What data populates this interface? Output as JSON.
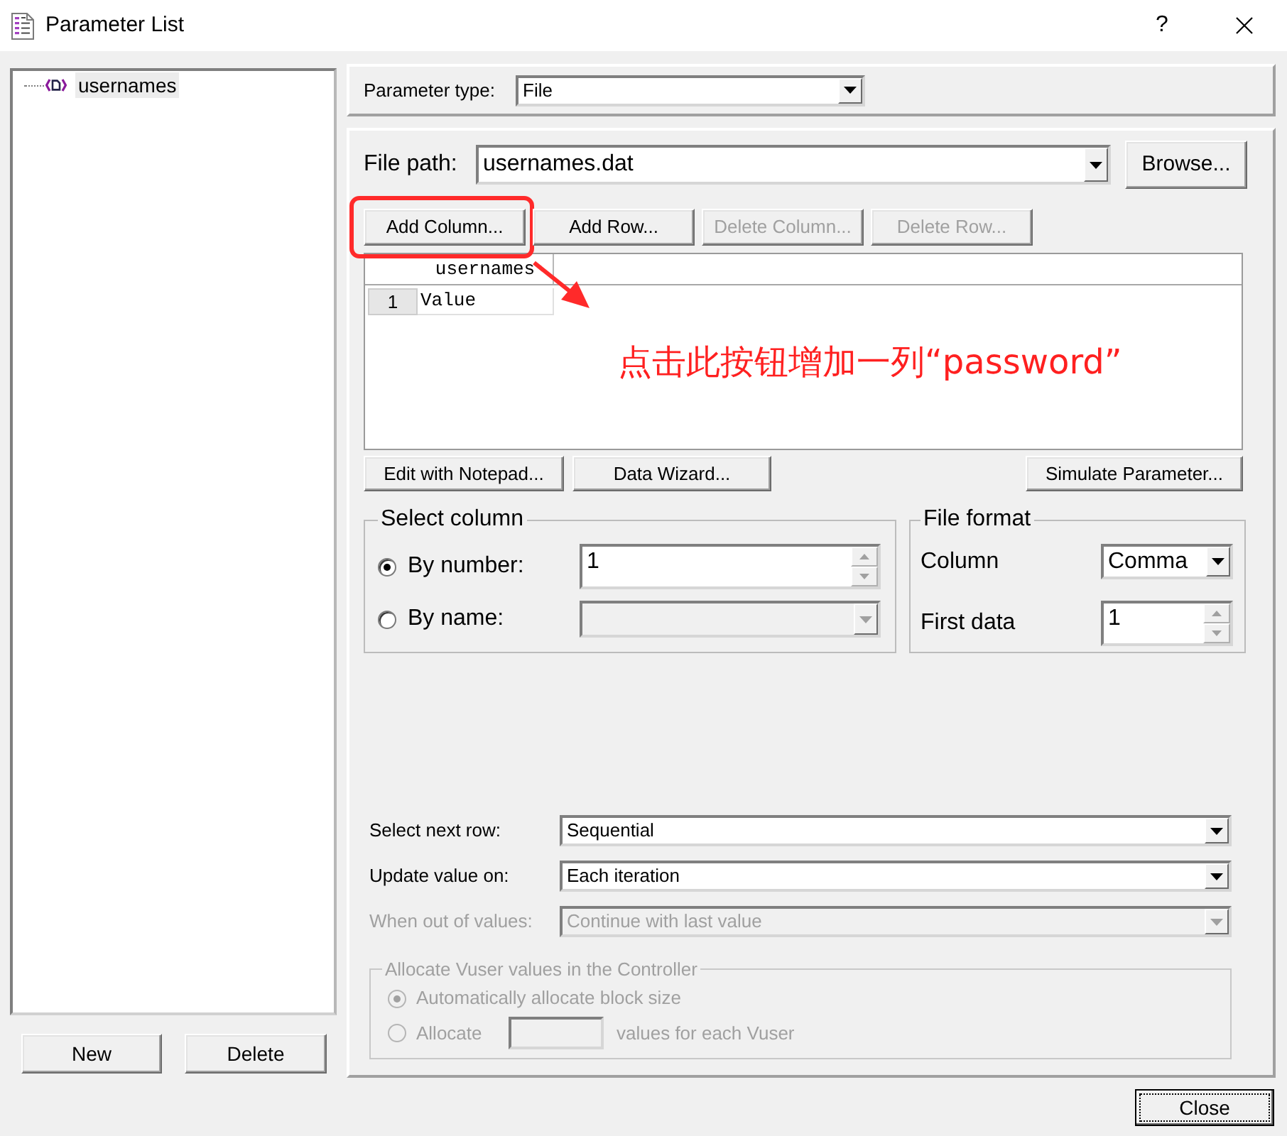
{
  "window": {
    "title": "Parameter List",
    "help_button": "?"
  },
  "parameter_tree": {
    "items": [
      {
        "label": "usernames",
        "selected": true
      }
    ],
    "buttons": [
      "New",
      "Delete"
    ]
  },
  "parameter_type": {
    "label": "Parameter type:",
    "value": "File"
  },
  "file_path": {
    "label": "File path:",
    "value": "usernames.dat",
    "browse_button": "Browse..."
  },
  "table_buttons": [
    {
      "label": "Add Column...",
      "disabled": false,
      "highlighted": true
    },
    {
      "label": "Add Row...",
      "disabled": false,
      "highlighted": false
    },
    {
      "label": "Delete Column...",
      "disabled": true,
      "highlighted": false
    },
    {
      "label": "Delete Row...",
      "disabled": true,
      "highlighted": false
    }
  ],
  "table": {
    "columns": [
      "usernames"
    ],
    "rows": [
      {
        "number": "1",
        "cells": [
          "Value"
        ]
      }
    ]
  },
  "annotation": {
    "text": "点击此按钮增加一列“password”"
  },
  "editor_buttons": [
    "Edit with Notepad...",
    "Data Wizard...",
    "Simulate Parameter..."
  ],
  "select_column": {
    "title": "Select column",
    "options": [
      {
        "label": "By number:",
        "selected": true,
        "field": {
          "kind": "spinner",
          "value": "1",
          "disabled": false
        }
      },
      {
        "label": "By name:",
        "selected": false,
        "field": {
          "kind": "dropdown",
          "disabled": true
        }
      }
    ]
  },
  "file_format": {
    "title": "File format",
    "fields": [
      {
        "label": "Column",
        "kind": "dropdown",
        "value": "Comma"
      },
      {
        "label": "First data",
        "kind": "spinner",
        "value": "1"
      }
    ]
  },
  "row_settings": [
    {
      "label": "Select next row:",
      "value": "Sequential",
      "disabled": false
    },
    {
      "label": "Update value on:",
      "value": "Each iteration",
      "disabled": false
    },
    {
      "label": "When out of values:",
      "value": "Continue with last value",
      "disabled": true
    }
  ],
  "allocation": {
    "title": "Allocate Vuser values in the Controller",
    "disabled": true,
    "options": [
      {
        "kind": "auto",
        "label": "Automatically allocate block size",
        "selected": true
      },
      {
        "kind": "count",
        "label": "Allocate",
        "suffix": "values for each Vuser",
        "selected": false
      }
    ]
  },
  "close_button": "Close"
}
